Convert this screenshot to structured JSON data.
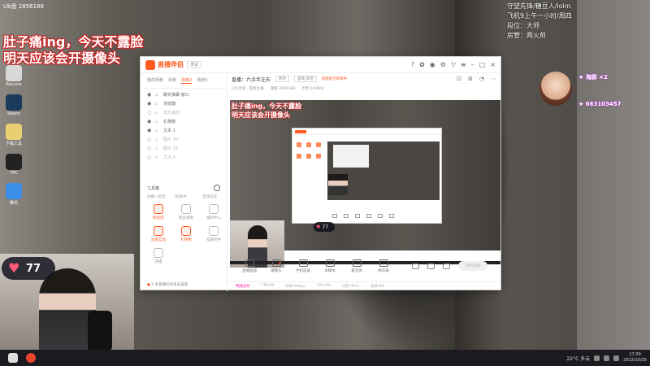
{
  "desktop": {
    "top_left_label": "Ub盘\n2856188",
    "overlay_line1": "肚子痛ing，今天不露脸",
    "overlay_line2": "明天应该会开摄像头",
    "icons": [
      {
        "label": "Recycle",
        "color": "#d8d8d8"
      },
      {
        "label": "Steam",
        "color": "#1b3a5c"
      },
      {
        "label": "下载工具",
        "color": "#e8d070"
      },
      {
        "label": "TPC",
        "color": "#222222"
      },
      {
        "label": "腾讯",
        "color": "#3a8ee6"
      }
    ],
    "top_right_lines": [
      "守望先锋/糖豆人/lolm",
      "飞机9上午一小时/周四",
      "段位：大师",
      "房管：两火煎"
    ],
    "side_stat_1": "★ 海豚 ×2",
    "side_stat_2": "★ 663103457"
  },
  "webcam": {
    "likes": "77"
  },
  "app": {
    "name": "直播伴侣",
    "version": "测试",
    "scene_tabs": [
      "我的场景",
      "场景",
      "场景2",
      "场景3"
    ],
    "active_tab_index": 2,
    "sources": [
      {
        "label": "聊天弹幕·窗口",
        "dim": false
      },
      {
        "label": "浏览器",
        "dim": false
      },
      {
        "label": "音乐播放",
        "dim": true
      },
      {
        "label": "礼物榜",
        "dim": false
      },
      {
        "label": "文本 1",
        "dim": false
      },
      {
        "label": "图片 20",
        "dim": true
      },
      {
        "label": "图片 19",
        "dim": true
      },
      {
        "label": "文本 4",
        "dim": true
      }
    ],
    "tools_title": "工具箱",
    "tools_top": [
      "主播一起玩",
      "连线PK",
      "互动玩法"
    ],
    "tools": [
      {
        "label": "粉丝团",
        "hot": true
      },
      {
        "label": "粉丝勋章",
        "hot": false
      },
      {
        "label": "福利中心",
        "hot": false
      },
      {
        "label": "连屏互动",
        "hot": true
      },
      {
        "label": "礼物秀",
        "hot": true
      },
      {
        "label": "投屏控件",
        "hot": false
      },
      {
        "label": "开播",
        "hot": false
      }
    ],
    "tip": "5 条直播间消息未查看",
    "stream_title": "直播：六点半左右",
    "edit_label": "修改",
    "category": "游戏-其他",
    "warning": "系统提示审核中",
    "sub_info": [
      "LOL手游 · 游戏主播",
      "观看 2856188",
      "点赞 142664"
    ],
    "preview_line1": "肚子痛ing，今天不露脸",
    "preview_line2": "明天应该会开摄像头",
    "preview_likes": "77",
    "controls": [
      "直播画面",
      "摄像头",
      "手机投屏",
      "多媒体",
      "麦克风",
      "扬声器"
    ],
    "start_label": "开始直播",
    "status": [
      "网络良好",
      "FPS:60",
      "码率:0kbps",
      "CPU:6%",
      "内存:35%",
      "丢帧:0%"
    ]
  },
  "taskbar": {
    "weather": "22°C 多云",
    "time": "17:09",
    "date": "2022/10/25"
  }
}
